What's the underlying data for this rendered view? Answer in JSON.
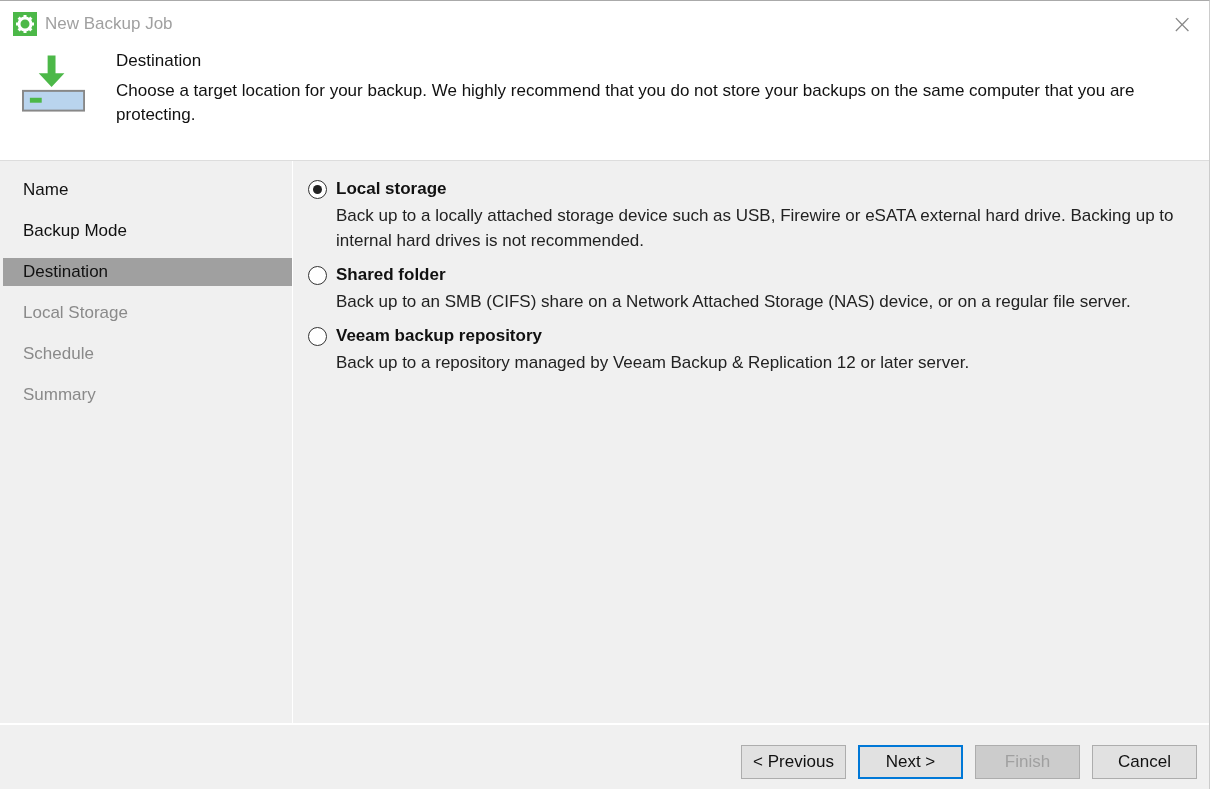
{
  "window": {
    "title": "New Backup Job",
    "close": "×"
  },
  "header": {
    "title": "Destination",
    "description": "Choose a target location for your backup. We highly recommend that you do not store your backups on the same computer that you are protecting."
  },
  "steps": [
    {
      "label": "Name",
      "selected": false,
      "disabled": false
    },
    {
      "label": "Backup Mode",
      "selected": false,
      "disabled": false
    },
    {
      "label": "Destination",
      "selected": true,
      "disabled": false
    },
    {
      "label": "Local Storage",
      "selected": false,
      "disabled": true
    },
    {
      "label": "Schedule",
      "selected": false,
      "disabled": true
    },
    {
      "label": "Summary",
      "selected": false,
      "disabled": true
    }
  ],
  "options": [
    {
      "label": "Local storage",
      "description": "Back up to a locally attached storage device such as USB, Firewire or eSATA external hard drive. Backing up to internal hard drives is not recommended.",
      "selected": true
    },
    {
      "label": "Shared folder",
      "description": "Back up to an SMB (CIFS) share on a Network Attached Storage (NAS) device, or on a regular file server.",
      "selected": false
    },
    {
      "label": "Veeam backup repository",
      "description": "Back up to a repository managed by Veeam Backup & Replication 12 or later server.",
      "selected": false
    }
  ],
  "buttons": [
    {
      "label": "< Previous",
      "focused": false,
      "disabled": false
    },
    {
      "label": "Next >",
      "focused": true,
      "disabled": false
    },
    {
      "label": "Finish",
      "focused": false,
      "disabled": true
    },
    {
      "label": "Cancel",
      "focused": false,
      "disabled": false
    }
  ]
}
